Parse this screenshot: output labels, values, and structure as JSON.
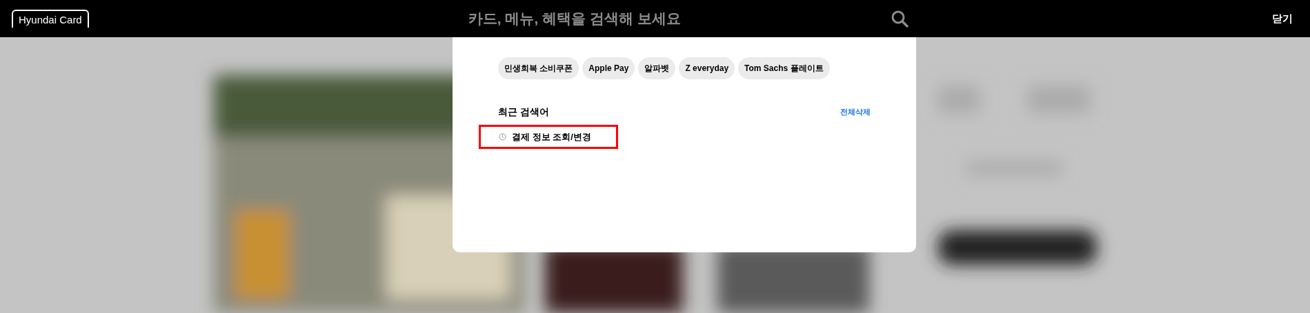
{
  "header": {
    "logo": "Hyundai Card",
    "search": {
      "placeholder": "카드, 메뉴, 혜택을 검색해 보세요"
    },
    "close": "닫기"
  },
  "suggestions": [
    "민생회복 소비쿠폰",
    "Apple Pay",
    "알파벳",
    "Z everyday",
    "Tom Sachs 플레이트"
  ],
  "recent": {
    "title": "최근 검색어",
    "clear_all": "전체삭제",
    "items": [
      {
        "label": "결제 정보 조회/변경",
        "highlighted": true
      }
    ]
  }
}
